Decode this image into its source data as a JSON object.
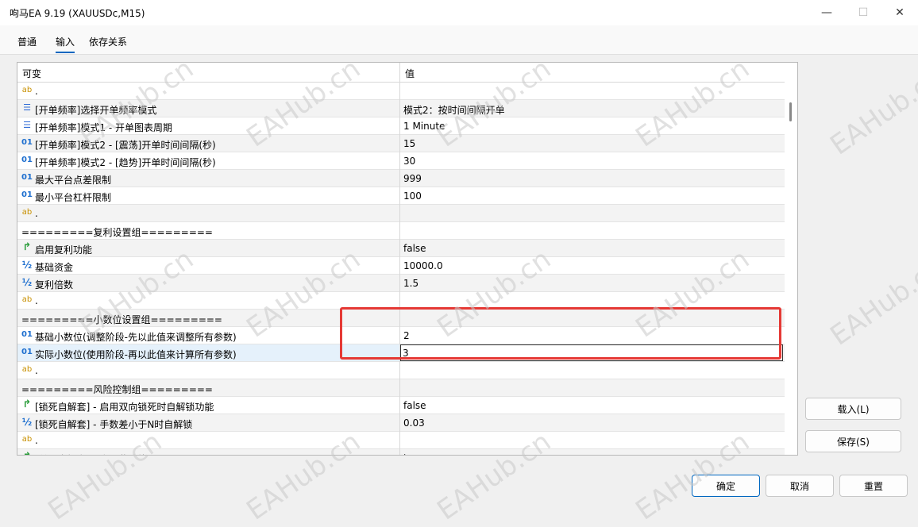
{
  "window": {
    "title": "呴马EA 9.19 (XAUUSDc,M15)"
  },
  "tabs": [
    "普通",
    "输入",
    "依存关系"
  ],
  "grid": {
    "headers": {
      "variable": "可变",
      "value": "值"
    },
    "rows": [
      {
        "icon": "ab",
        "label": ".",
        "value": ""
      },
      {
        "icon": "enum",
        "label": "[开单频率]选择开单频率模式",
        "value": "模式2：按时间间隔开单"
      },
      {
        "icon": "enum",
        "label": "[开单频率]模式1 - 开单图表周期",
        "value": "1 Minute"
      },
      {
        "icon": "01",
        "label": "[开单频率]模式2 - [震荡]开单时间间隔(秒)",
        "value": "15"
      },
      {
        "icon": "01",
        "label": "[开单频率]模式2 - [趋势]开单时间间隔(秒)",
        "value": "30"
      },
      {
        "icon": "01",
        "label": "最大平台点差限制",
        "value": "999"
      },
      {
        "icon": "01",
        "label": "最小平台杠杆限制",
        "value": "100"
      },
      {
        "icon": "ab",
        "label": ".",
        "value": ""
      },
      {
        "icon": "",
        "label": "=========复利设置组=========",
        "value": ""
      },
      {
        "icon": "bool",
        "label": "启用复利功能",
        "value": "false"
      },
      {
        "icon": "half",
        "label": "基础资金",
        "value": "10000.0"
      },
      {
        "icon": "half",
        "label": "复利倍数",
        "value": "1.5"
      },
      {
        "icon": "ab",
        "label": ".",
        "value": ""
      },
      {
        "icon": "",
        "label": "=========小数位设置组=========",
        "value": ""
      },
      {
        "icon": "01",
        "label": "基础小数位(调整阶段-先以此值来调整所有参数)",
        "value": "2"
      },
      {
        "icon": "01",
        "label": "实际小数位(使用阶段-再以此值来计算所有参数)",
        "value": "3",
        "editing": true
      },
      {
        "icon": "ab",
        "label": ".",
        "value": ""
      },
      {
        "icon": "",
        "label": "=========风险控制组=========",
        "value": ""
      },
      {
        "icon": "bool",
        "label": "[锁死自解套] - 启用双向锁死时自解锁功能",
        "value": "false"
      },
      {
        "icon": "half",
        "label": "[锁死自解套] - 手数差小于N时自解锁",
        "value": "0.03"
      },
      {
        "icon": "ab",
        "label": ".",
        "value": ""
      },
      {
        "icon": "bool",
        "label": "[单边自解套] - 启用此功能",
        "value": "true"
      }
    ]
  },
  "side_buttons": {
    "load": "载入(L)",
    "save": "保存(S)"
  },
  "footer_buttons": {
    "ok": "确定",
    "cancel": "取消",
    "reset": "重置"
  },
  "watermark_text": "EAHub.cn"
}
